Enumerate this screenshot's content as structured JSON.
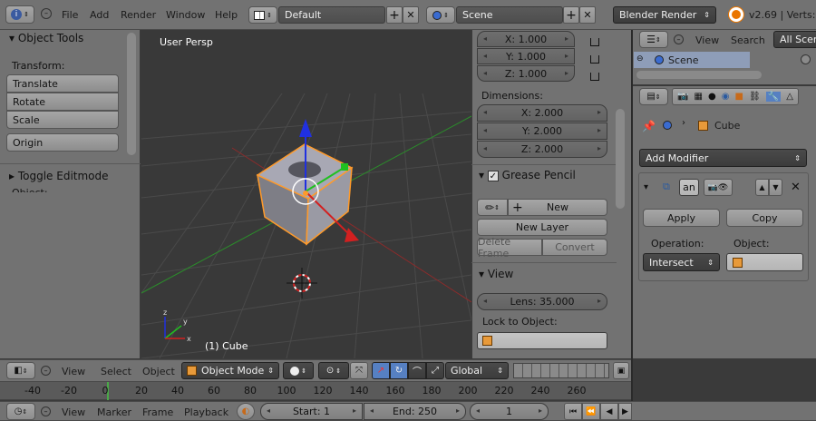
{
  "top_menu": {
    "items": [
      "File",
      "Add",
      "Render",
      "Window",
      "Help"
    ],
    "layout": "Default",
    "scene": "Scene",
    "engine": "Blender Render",
    "version": "v2.69 | Verts:"
  },
  "tool_shelf": {
    "title": "Object Tools",
    "transform_label": "Transform:",
    "buttons": [
      "Translate",
      "Rotate",
      "Scale"
    ],
    "origin": "Origin",
    "toggle_editmode": "Toggle Editmode",
    "cut_label": "Object:"
  },
  "viewport": {
    "persp": "User Persp",
    "object_label": "(1) Cube"
  },
  "n_panel": {
    "loc_x": "X: 1.000",
    "loc_y": "Y: 1.000",
    "loc_z": "Z: 1.000",
    "dimensions_label": "Dimensions:",
    "dim_x": "X: 2.000",
    "dim_y": "Y: 2.000",
    "dim_z": "Z: 2.000",
    "grease_pencil": "Grease Pencil",
    "new": "New",
    "new_layer": "New Layer",
    "delete_frame": "Delete Frame",
    "convert": "Convert",
    "view": "View",
    "lens": "Lens: 35.000",
    "lock_to_object": "Lock to Object:"
  },
  "outliner": {
    "view": "View",
    "search": "Search",
    "all_scenes": "All Scen",
    "scene": "Scene"
  },
  "properties": {
    "object_name": "Cube",
    "add_modifier": "Add Modifier",
    "modifier_name": "an",
    "apply": "Apply",
    "copy": "Copy",
    "operation_label": "Operation:",
    "object_label": "Object:",
    "operation_value": "Intersect"
  },
  "view3d_header": {
    "view": "View",
    "select": "Select",
    "object": "Object",
    "mode": "Object Mode",
    "orientation": "Global"
  },
  "timeline": {
    "ticks": [
      "-40",
      "-20",
      "0",
      "20",
      "40",
      "60",
      "80",
      "100",
      "120",
      "140",
      "160",
      "180",
      "200",
      "220",
      "240",
      "260"
    ],
    "view": "View",
    "marker": "Marker",
    "frame": "Frame",
    "playback": "Playback",
    "start": "Start: 1",
    "end": "End: 250",
    "current": "1"
  },
  "colors": {
    "panel_bg": "#727272",
    "viewport_bg": "#393939",
    "accent_blue": "#5680c2",
    "x_axis": "#d32020",
    "y_axis": "#20c020",
    "z_axis": "#2030e0",
    "selection_orange": "#ff9a2a"
  }
}
